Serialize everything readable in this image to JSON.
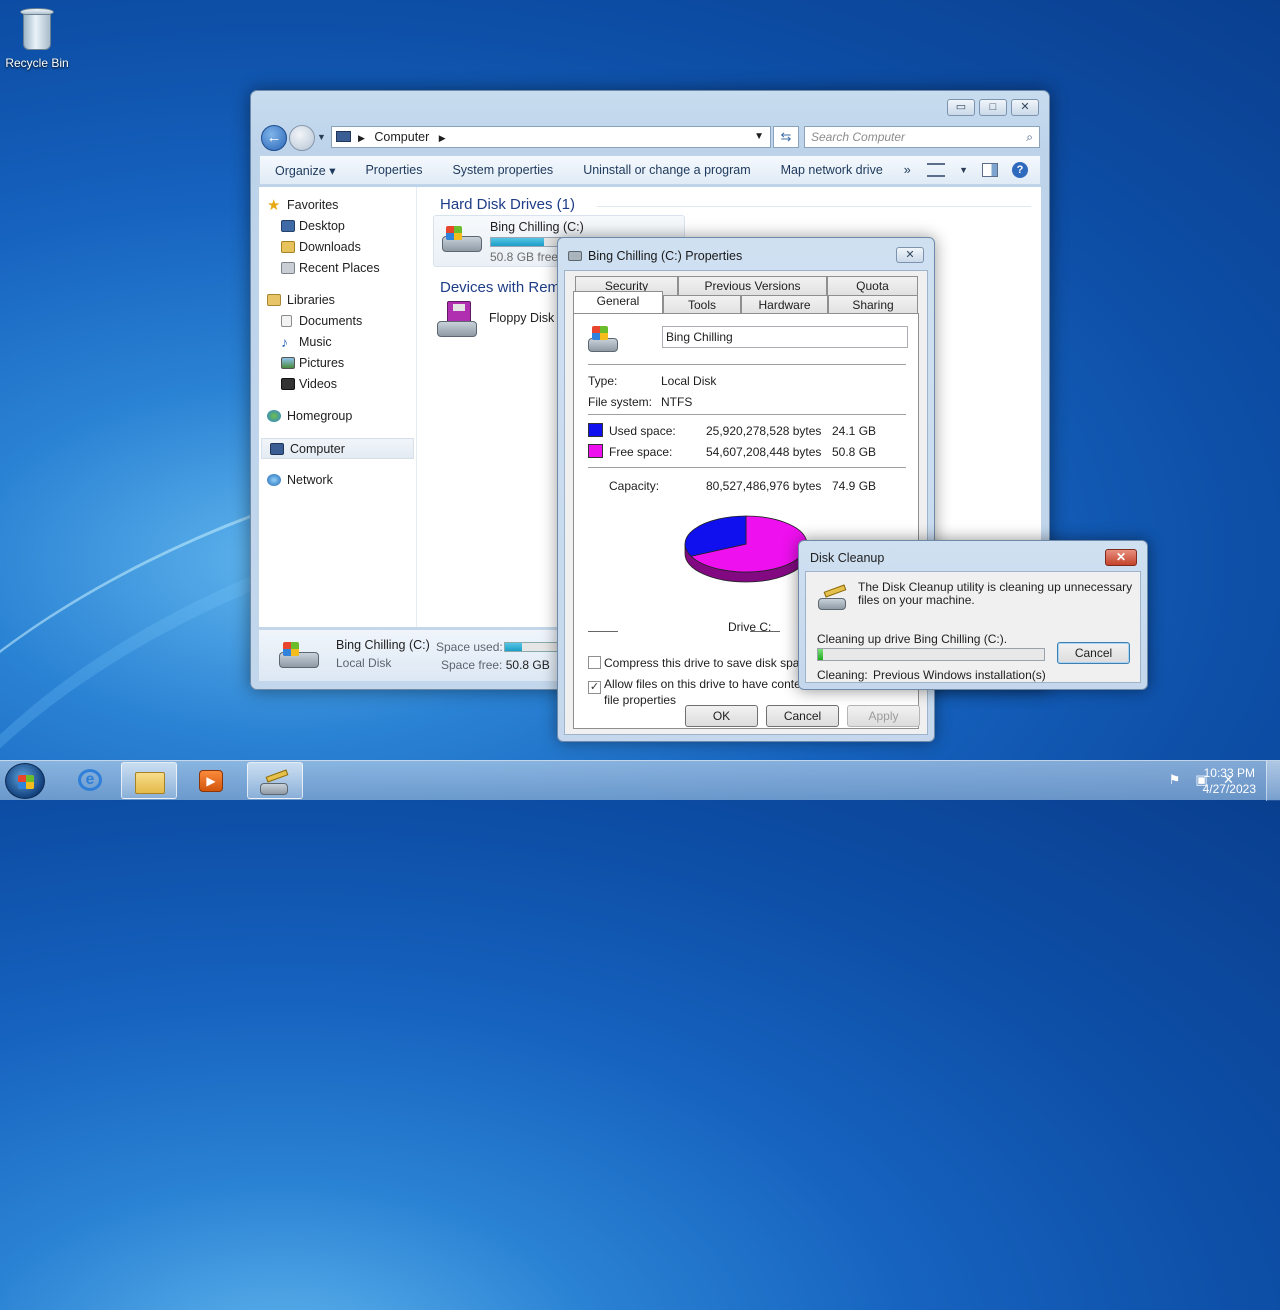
{
  "desktop": {
    "icons": [
      {
        "label": "Recycle Bin",
        "icon": "recycle-bin-icon"
      }
    ]
  },
  "explorer": {
    "address": {
      "location": "Computer"
    },
    "search": {
      "placeholder": "Search Computer"
    },
    "window_buttons": {
      "minimize": "▭",
      "maximize": "□",
      "close": "✕"
    },
    "toolbar": {
      "organize": "Organize ▾",
      "properties": "Properties",
      "system_properties": "System properties",
      "uninstall": "Uninstall or change a program",
      "map_drive": "Map network drive",
      "more": "»"
    },
    "nav": {
      "favorites": "Favorites",
      "desktop": "Desktop",
      "downloads": "Downloads",
      "recent_places": "Recent Places",
      "libraries": "Libraries",
      "documents": "Documents",
      "music": "Music",
      "pictures": "Pictures",
      "videos": "Videos",
      "homegroup": "Homegroup",
      "computer": "Computer",
      "network": "Network"
    },
    "groups": {
      "hard_disks": "Hard Disk Drives (1)",
      "removable": "Devices with Remo"
    },
    "drive": {
      "name": "Bing Chilling (C:)",
      "free_text": "50.8 GB free o",
      "used_fraction": 0.3
    },
    "floppy": {
      "name": "Floppy Disk D"
    },
    "details": {
      "name": "Bing Chilling (C:)",
      "type": "Local Disk",
      "space_used_label": "Space used:",
      "space_free_label": "Space free:",
      "space_free_value": "50.8 GB",
      "used_fraction": 0.3
    }
  },
  "properties": {
    "title": "Bing Chilling (C:) Properties",
    "close": "✕",
    "tabs_row1": [
      "Security",
      "Previous Versions",
      "Quota"
    ],
    "tabs_row2": [
      "General",
      "Tools",
      "Hardware",
      "Sharing"
    ],
    "label_value": "Bing Chilling",
    "type_label": "Type:",
    "type_value": "Local Disk",
    "fs_label": "File system:",
    "fs_value": "NTFS",
    "used_label": "Used space:",
    "used_bytes": "25,920,278,528 bytes",
    "used_gb": "24.1 GB",
    "free_label": "Free space:",
    "free_bytes": "54,607,208,448 bytes",
    "free_gb": "50.8 GB",
    "capacity_label": "Capacity:",
    "capacity_bytes": "80,527,486,976 bytes",
    "capacity_gb": "74.9 GB",
    "drive_label": "Drive C:",
    "compress_label": "Compress this drive to save disk space",
    "index_label_1": "Allow files on this drive to have contents i",
    "index_label_2": "file properties",
    "ok": "OK",
    "cancel": "Cancel",
    "apply": "Apply",
    "colors": {
      "used": "#1010ee",
      "free": "#ee10ee"
    },
    "used_fraction": 0.322
  },
  "cleanup": {
    "title": "Disk Cleanup",
    "close": "✕",
    "message": "The Disk Cleanup utility is cleaning up unnecessary files on your machine.",
    "status": "Cleaning up drive Bing Chilling (C:).",
    "cleaning_label": "Cleaning:",
    "cleaning_item": "Previous Windows installation(s)",
    "cancel": "Cancel",
    "progress": 0.02
  },
  "taskbar": {
    "time": "10:33 PM",
    "date": "4/27/2023"
  }
}
